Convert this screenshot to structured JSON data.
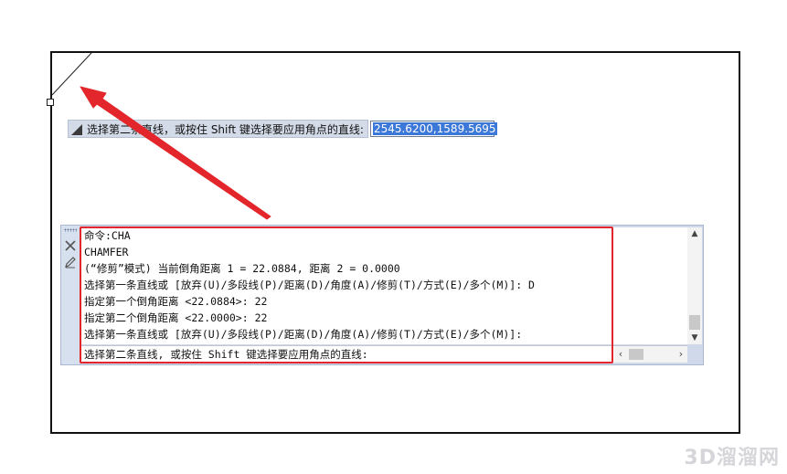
{
  "dynamic_prompt": {
    "text": "选择第二条直线，或按住 Shift 键选择要应用角点的直线:",
    "coordinates": "2545.6200,1589.5695"
  },
  "command_window": {
    "history": [
      "命令:CHA",
      "CHAMFER",
      "(“修剪”模式) 当前倒角距离 1 = 22.0884, 距离 2 = 0.0000",
      "选择第一条直线或 [放弃(U)/多段线(P)/距离(D)/角度(A)/修剪(T)/方式(E)/多个(M)]: D",
      "指定第一个倒角距离 <22.0884>: 22",
      "指定第二个倒角距离 <22.0000>: 22",
      "选择第一条直线或 [放弃(U)/多段线(P)/距离(D)/角度(A)/修剪(T)/方式(E)/多个(M)]:"
    ],
    "current_prompt": "选择第二条直线, 或按住 Shift 键选择要应用角点的直线:",
    "icons": {
      "close": "close-icon",
      "customize": "pen-icon"
    }
  },
  "colors": {
    "annotation_red": "#e3262b",
    "panel_blue": "#cfd9ea",
    "selection_blue": "#3c78d8"
  },
  "watermark": "3D溜溜网"
}
